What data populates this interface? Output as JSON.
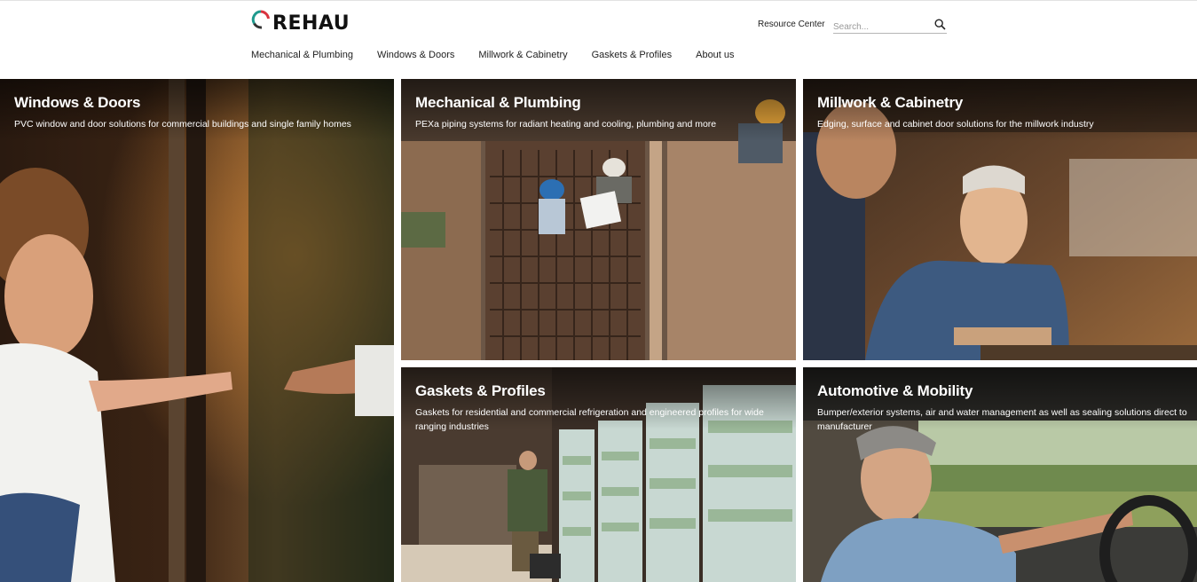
{
  "brand": {
    "name": "REHAU"
  },
  "header": {
    "resource_center": "Resource Center",
    "search_placeholder": "Search..."
  },
  "nav": [
    {
      "label": "Mechanical & Plumbing"
    },
    {
      "label": "Windows & Doors"
    },
    {
      "label": "Millwork & Cabinetry"
    },
    {
      "label": "Gaskets & Profiles"
    },
    {
      "label": "About us"
    }
  ],
  "tiles": [
    {
      "title": "Windows & Doors",
      "desc": "PVC window and door solutions for commercial buildings and single family homes"
    },
    {
      "title": "Mechanical & Plumbing",
      "desc": "PEXa piping systems for radiant heating and cooling, plumbing and more"
    },
    {
      "title": "Millwork & Cabinetry",
      "desc": "Edging, surface and cabinet door solutions for the millwork industry"
    },
    {
      "title": "Gaskets & Profiles",
      "desc": "Gaskets for residential and commercial refrigeration and engineered profiles for wide ranging industries"
    },
    {
      "title": "Automotive & Mobility",
      "desc": "Bumper/exterior systems, air and water management as well as sealing solutions direct to manufacturer"
    }
  ],
  "colors": {
    "brand_red": "#d9343f",
    "brand_teal": "#1f9a8e",
    "brand_dark": "#111111"
  }
}
